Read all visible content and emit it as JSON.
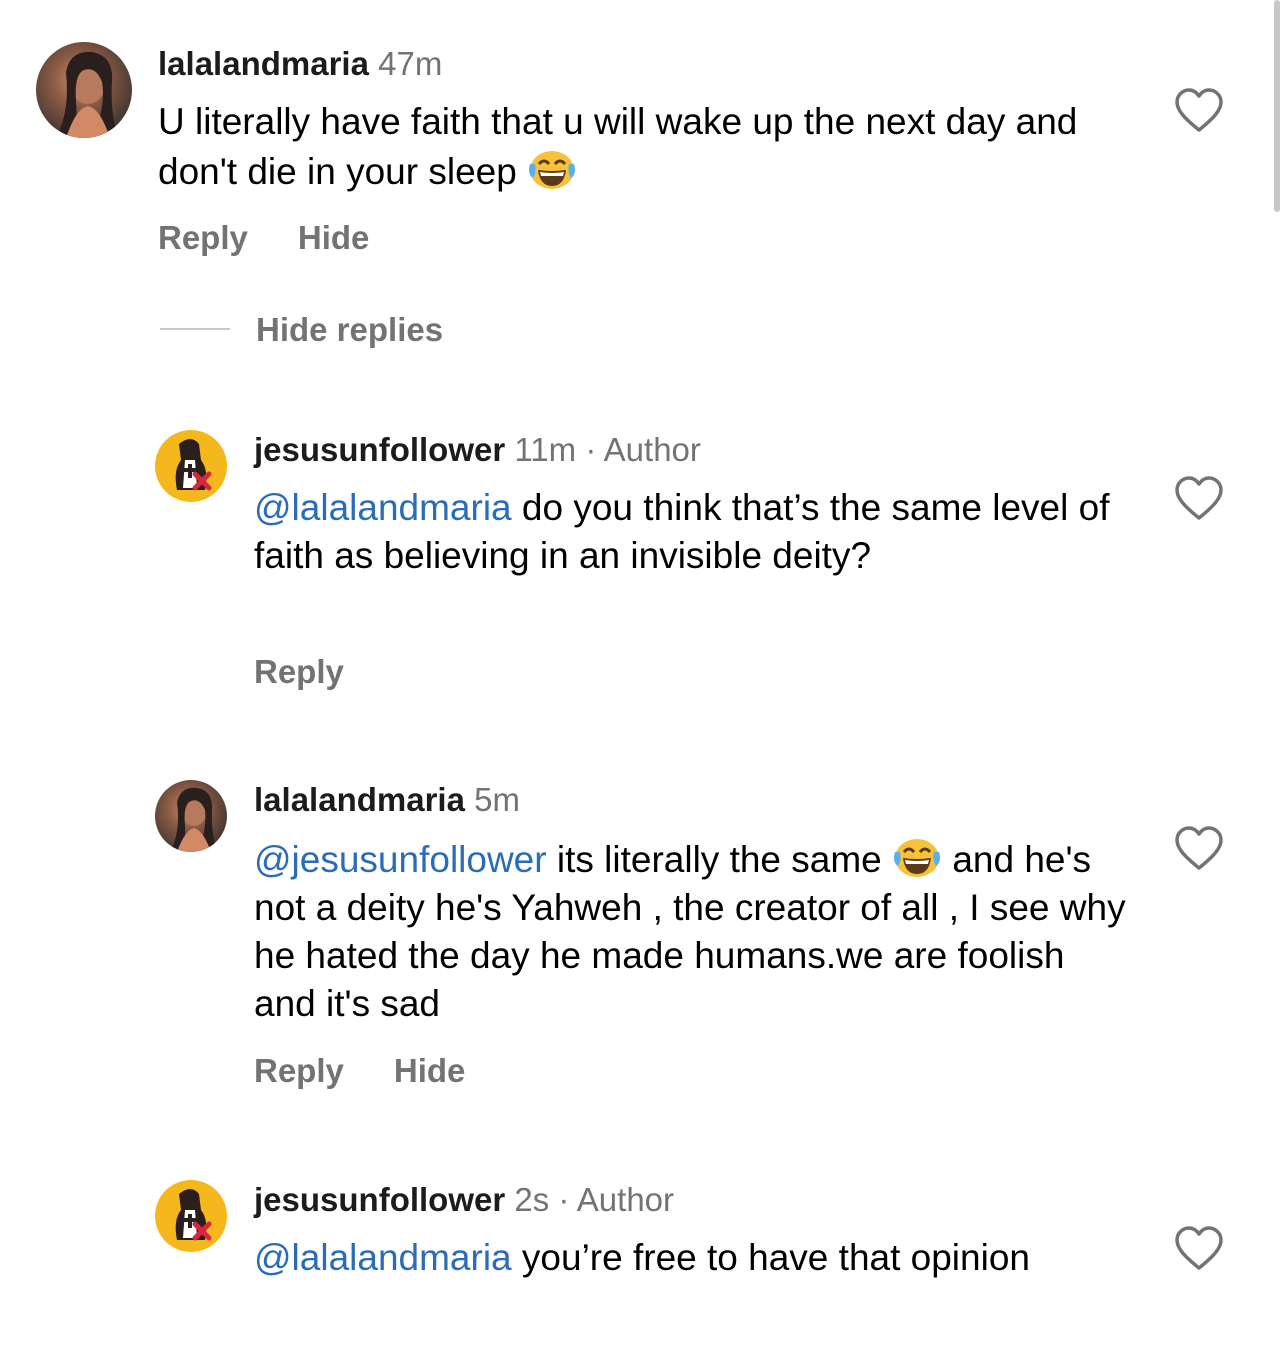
{
  "comments": [
    {
      "username": "lalalandmaria",
      "time": "47m",
      "author_label": "",
      "mention": "",
      "text": "U literally have faith that u will wake up the next day and don't die in your sleep",
      "emoji": "face-with-tears-of-joy",
      "reply_label": "Reply",
      "hide_label": "Hide"
    },
    {
      "username": "jesusunfollower",
      "time": "11m",
      "author_label": "Author",
      "mention": "@lalalandmaria",
      "text": " do you think that’s the same level of faith as believing in an invisible deity?",
      "reply_label": "Reply"
    },
    {
      "username": "lalalandmaria",
      "time": "5m",
      "author_label": "",
      "mention": "@jesusunfollower",
      "text": " its literally the same",
      "emoji": "face-with-tears-of-joy",
      "text_after": "and he's not a deity he's Yahweh , the creator of all , I see why he hated the day he made humans.we are foolish and it's sad",
      "reply_label": "Reply",
      "hide_label": "Hide"
    },
    {
      "username": "jesusunfollower",
      "time": "2s",
      "author_label": "Author",
      "mention": "@lalalandmaria",
      "text": " you’re free to have that opinion"
    }
  ],
  "hide_replies_label": "Hide replies",
  "separator": "·",
  "colors": {
    "mention": "#2b6cb8",
    "secondary_text": "#737373",
    "logo_avatar": "#f5b81c"
  }
}
